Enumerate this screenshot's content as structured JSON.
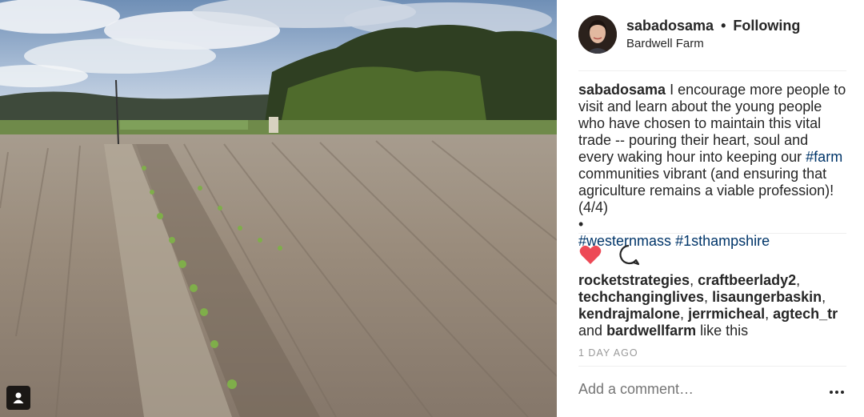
{
  "post": {
    "username": "sabadosama",
    "follow_status": "Following",
    "separator": "•",
    "location": "Bardwell Farm",
    "caption": {
      "author": "sabadosama",
      "text_1": " I encourage more people to visit and learn about the young people who have chosen to maintain this vital trade -- pouring their heart, soul and every waking hour into keeping our ",
      "hashtag_farm": "#farm",
      "text_2": " communities vibrant (and ensuring that agriculture remains a viable profession)! (4/4)",
      "bullet": "•",
      "hashtag_westernmass": "#westernmass",
      "hashtag_1sthampshire": "#1sthampshire"
    },
    "likes": {
      "users": [
        "rocketstrategies",
        "craftbeerlady2",
        "techchanginglives",
        "lisaungerbaskin",
        "kendrajmalone",
        "jerrmicheal",
        "agtech_tr"
      ],
      "and_text": "and",
      "last_user": "bardwellfarm",
      "suffix": "like this"
    },
    "timestamp": "1 DAY AGO",
    "comment_placeholder": "Add a comment…"
  },
  "icons": {
    "like": "heart-filled-icon",
    "comment": "comment-bubble-icon",
    "more": "more-dots-icon",
    "user_tag": "user-tag-icon"
  },
  "colors": {
    "heart": "#ed4956",
    "hashtag": "#003569",
    "muted": "#999999",
    "text": "#262626"
  }
}
